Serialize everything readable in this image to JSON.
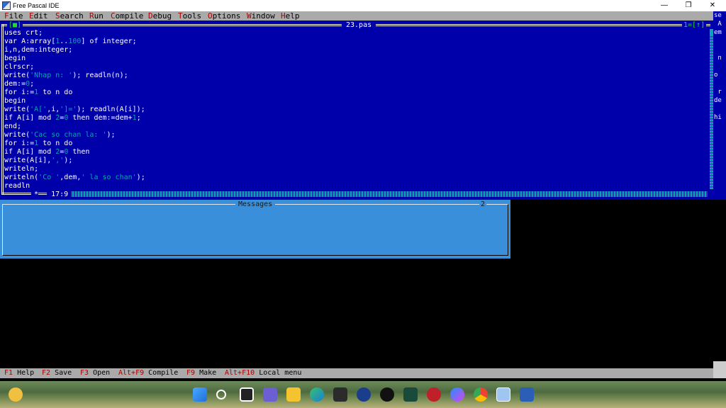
{
  "window": {
    "title": "Free Pascal IDE",
    "minimize_glyph": "—",
    "maximize_glyph": "❐",
    "close_glyph": "✕"
  },
  "menu": {
    "items": [
      {
        "hot": "F",
        "rest": "ile"
      },
      {
        "hot": "E",
        "rest": "dit"
      },
      {
        "hot": "S",
        "rest": "earch"
      },
      {
        "hot": "R",
        "rest": "un"
      },
      {
        "hot": "C",
        "rest": "ompile"
      },
      {
        "hot": "D",
        "rest": "ebug"
      },
      {
        "hot": "T",
        "rest": "ools"
      },
      {
        "hot": "O",
        "rest": "ptions"
      },
      {
        "hot": "W",
        "rest": "indow"
      },
      {
        "hot": "H",
        "rest": "elp"
      }
    ]
  },
  "editor": {
    "close_box": "[■]",
    "file_name": "23.pas",
    "window_number": "1=[↑]",
    "cursor_position": "17:9",
    "modified_marker": "*",
    "code_lines": [
      "uses crt;",
      "var A:array[1..100] of integer;",
      "i,n,dem:integer;",
      "begin",
      "clrscr;",
      "write('Nhap n: '); readln(n);",
      "dem:=0;",
      "for i:=1 to n do",
      "begin",
      "write('A[',i,']='); readln(A[i]);",
      "if A[i] mod 2=0 then dem:=dem+1;",
      "end;",
      "write('Cac so chan la: ');",
      "for i:=1 to n do",
      "if A[i] mod 2=0 then",
      "write(A[i],',');",
      "writeln;",
      "writeln('Co ',dem,' la so chan');",
      "readln"
    ]
  },
  "side_window_fragment": "se\n A\nem\n\n\n n\n\no\n\n r\nde\n\nhi",
  "messages": {
    "title": "Messages",
    "window_number": "2"
  },
  "statusbar": {
    "items": [
      {
        "key": "F1",
        "label": "Help"
      },
      {
        "key": "F2",
        "label": "Save"
      },
      {
        "key": "F3",
        "label": "Open"
      },
      {
        "key": "Alt+F9",
        "label": "Compile"
      },
      {
        "key": "F9",
        "label": "Make"
      },
      {
        "key": "Alt+F10",
        "label": "Local menu"
      }
    ]
  },
  "colors": {
    "editor_bg": "#0000aa",
    "messages_bg": "#3a8fdb",
    "menu_bg": "#aaaaaa",
    "hotkey": "#aa0000",
    "number_literal": "#00aaaa"
  },
  "taskbar": {
    "icons": [
      "weather-icon",
      "start-icon",
      "search-icon",
      "task-view-icon",
      "teams-icon",
      "file-explorer-icon",
      "edge-icon",
      "store-icon",
      "ccleaner-icon",
      "tiktok-icon",
      "app-icon",
      "app-red-icon",
      "messenger-icon",
      "chrome-icon",
      "free-pascal-icon",
      "word-icon"
    ]
  }
}
